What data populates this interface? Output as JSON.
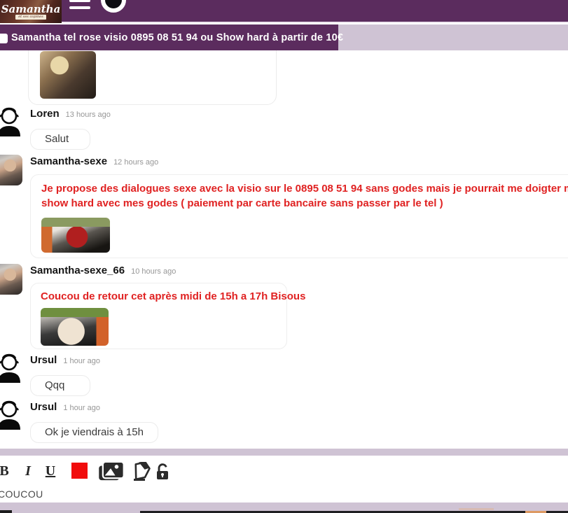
{
  "header": {
    "logo_title": "Samantha",
    "logo_subtitle": "et ses copines"
  },
  "banner": {
    "text": "Samantha tel rose visio 0895 08 51 94 ou Show hard à partir de 10€"
  },
  "messages": [
    {
      "author": "",
      "time": "",
      "text": "",
      "image": "blonde-selfie-photo"
    },
    {
      "author": "Loren",
      "time": "13 hours ago",
      "text": "Salut"
    },
    {
      "author": "Samantha-sexe",
      "time": "12 hours ago",
      "line1": "Je propose des dialogues sexe avec la visio sur le 0895 08 51 94 sans godes mais je pourrait me doigter ma chatte",
      "line2": "show hard avec mes godes ( paiement par carte bancaire sans passer par le tel )",
      "image": "red-dress-webcam-photo"
    },
    {
      "author": "Samantha-sexe_66",
      "time": "10 hours ago",
      "text": "Coucou de retour cet après midi de 15h a 17h Bisous",
      "image": "white-lingerie-webcam-photo"
    },
    {
      "author": "Ursul",
      "time": "1 hour ago",
      "text": "Qqq"
    },
    {
      "author": "Ursul",
      "time": "1 hour ago",
      "text": "Ok je viendrais à 15h"
    }
  ],
  "toolbar": {
    "bold_label": "B",
    "italic_label": "I",
    "underline_label": "U",
    "color_swatch": "#f10c0c",
    "icons": [
      "image-picker",
      "eraser",
      "unlock"
    ]
  },
  "composer": {
    "text": "COUCOU"
  },
  "colors": {
    "topbar_purple": "#5b2c5e",
    "lavender_strip": "#cfc3d4",
    "message_red": "#e02222"
  }
}
